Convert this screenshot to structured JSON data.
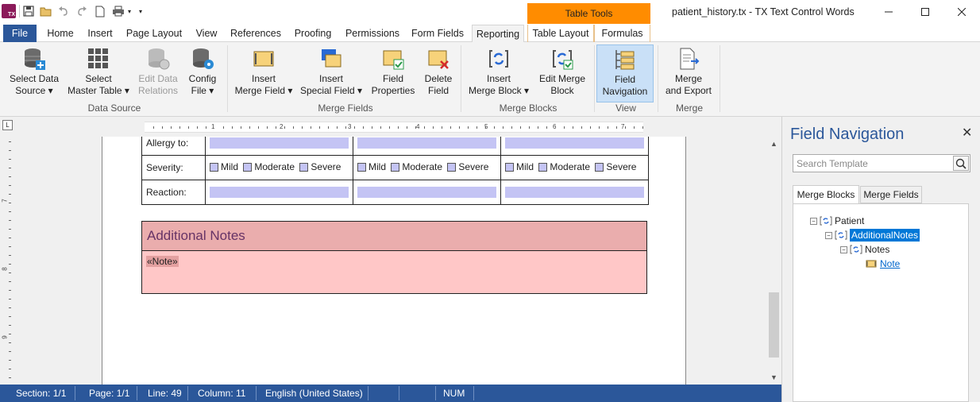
{
  "titlebar": {
    "logo_text": "TX",
    "context_tab": "Table Tools",
    "window_title": "patient_history.tx - TX Text Control Words"
  },
  "tabs": [
    {
      "label": "File"
    },
    {
      "label": "Home"
    },
    {
      "label": "Insert"
    },
    {
      "label": "Page Layout"
    },
    {
      "label": "View"
    },
    {
      "label": "References"
    },
    {
      "label": "Proofing"
    },
    {
      "label": "Permissions"
    },
    {
      "label": "Form Fields"
    },
    {
      "label": "Reporting"
    },
    {
      "label": "Table Layout"
    },
    {
      "label": "Formulas"
    }
  ],
  "ribbon": {
    "buttons": [
      {
        "line1": "Select Data",
        "line2": "Source ▾"
      },
      {
        "line1": "Select",
        "line2": "Master Table ▾"
      },
      {
        "line1": "Edit Data",
        "line2": "Relations"
      },
      {
        "line1": "Config",
        "line2": "File ▾"
      },
      {
        "line1": "Insert",
        "line2": "Merge Field ▾"
      },
      {
        "line1": "Insert",
        "line2": "Special Field ▾"
      },
      {
        "line1": "Field",
        "line2": "Properties"
      },
      {
        "line1": "Delete",
        "line2": "Field"
      },
      {
        "line1": "Insert",
        "line2": "Merge Block ▾"
      },
      {
        "line1": "Edit Merge",
        "line2": "Block"
      },
      {
        "line1": "Field",
        "line2": "Navigation"
      },
      {
        "line1": "Merge",
        "line2": "and Export"
      }
    ],
    "groups": [
      "Data Source",
      "Merge Fields",
      "Merge Blocks",
      "View",
      "Merge"
    ]
  },
  "ruler": {
    "numbers": [
      "1",
      "2",
      "3",
      "4",
      "5",
      "6",
      "7"
    ],
    "v_numbers": [
      "7",
      "8",
      "9"
    ]
  },
  "document": {
    "rows": [
      {
        "label": "Allergy to:",
        "type": "field"
      },
      {
        "label": "Severity:",
        "type": "checks"
      },
      {
        "label": "Reaction:",
        "type": "field"
      }
    ],
    "severity_options": [
      "Mild",
      "Moderate",
      "Severe"
    ],
    "notes_heading": "Additional Notes",
    "notes_field": "«Note»"
  },
  "panel": {
    "title": "Field Navigation",
    "search_placeholder": "Search Template",
    "tabs": [
      "Merge Blocks",
      "Merge Fields"
    ],
    "tree": [
      {
        "label": "Patient"
      },
      {
        "label": "AdditionalNotes"
      },
      {
        "label": "Notes"
      },
      {
        "label": "Note"
      }
    ]
  },
  "status": {
    "section": "Section: 1/1",
    "page": "Page: 1/1",
    "line": "Line: 49",
    "column": "Column: 11",
    "language": "English (United States)",
    "num": "NUM"
  },
  "colors": {
    "accent": "#2b579a",
    "context_tab": "#ff8c00",
    "merge_field": "#c4c4f4",
    "notes_header": "#eaadad",
    "notes_body": "#ffc7c7"
  }
}
